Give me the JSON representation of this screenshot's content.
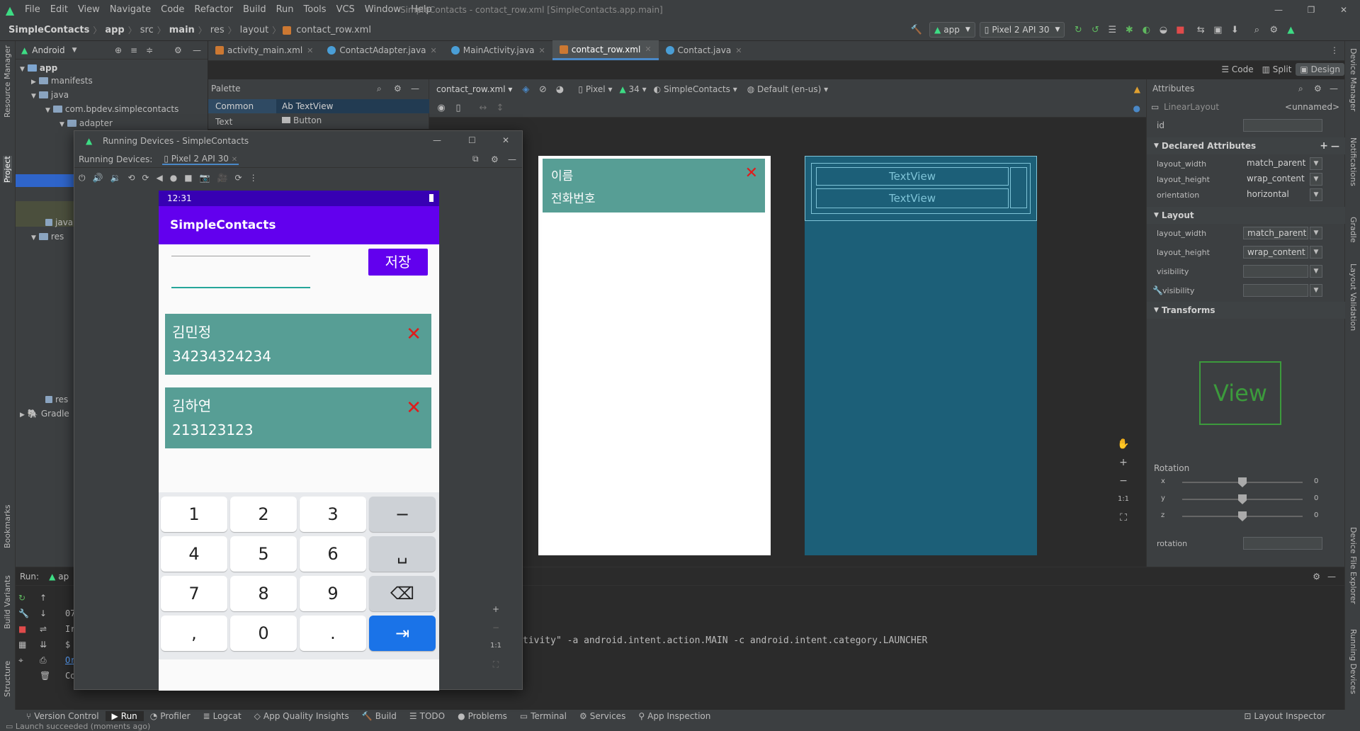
{
  "menu": [
    "File",
    "Edit",
    "View",
    "Navigate",
    "Code",
    "Refactor",
    "Build",
    "Run",
    "Tools",
    "VCS",
    "Window",
    "Help"
  ],
  "window_title": "SimpleContacts - contact_row.xml [SimpleContacts.app.main]",
  "breadcrumb": [
    "SimpleContacts",
    "app",
    "src",
    "main",
    "res",
    "layout",
    "contact_row.xml"
  ],
  "run_config": {
    "module": "app",
    "device": "Pixel 2 API 30"
  },
  "project": {
    "view_label": "Android",
    "rows": [
      "app",
      "manifests",
      "java",
      "com.bpdev.simplecontacts",
      "adapter",
      "java",
      "res",
      "res",
      "Gradle"
    ]
  },
  "tabs": [
    {
      "label": "activity_main.xml",
      "color": "#cc7832",
      "active": false
    },
    {
      "label": "ContactAdapter.java",
      "color": "#4a9ed6",
      "active": false
    },
    {
      "label": "MainActivity.java",
      "color": "#4a9ed6",
      "active": false
    },
    {
      "label": "contact_row.xml",
      "color": "#cc7832",
      "active": true
    },
    {
      "label": "Contact.java",
      "color": "#4a9ed6",
      "active": false
    }
  ],
  "view_modes": {
    "code": "Code",
    "split": "Split",
    "design": "Design"
  },
  "palette": {
    "title": "Palette",
    "categories": [
      "Common",
      "Text"
    ],
    "items": [
      "Ab TextView",
      "Button"
    ]
  },
  "design_toolbar": {
    "file": "contact_row.xml",
    "device": "Pixel",
    "api": "34",
    "theme": "SimpleContacts",
    "locale": "Default (en-us)"
  },
  "preview": {
    "name": "이름",
    "phone": "전화번호",
    "blueprint_text1": "TextView",
    "blueprint_text2": "TextView"
  },
  "attributes": {
    "title": "Attributes",
    "component": "LinearLayout",
    "component_id": "<unnamed>",
    "id_label": "id",
    "declared_title": "Declared Attributes",
    "declared": [
      {
        "name": "layout_width",
        "value": "match_parent"
      },
      {
        "name": "layout_height",
        "value": "wrap_content"
      },
      {
        "name": "orientation",
        "value": "horizontal"
      }
    ],
    "layout_title": "Layout",
    "layout": [
      {
        "name": "layout_width",
        "value": "match_parent"
      },
      {
        "name": "layout_height",
        "value": "wrap_content"
      },
      {
        "name": "visibility",
        "value": ""
      },
      {
        "name": "visibility",
        "value": ""
      }
    ],
    "transforms_title": "Transforms",
    "view_box": "View",
    "rotation_title": "Rotation",
    "rotation_axes": [
      "x",
      "y",
      "z"
    ],
    "rotation_values": [
      "0",
      "0",
      "0"
    ],
    "rotation_label": "rotation"
  },
  "emulator": {
    "title": "Running Devices - SimpleContacts",
    "tab_label": "Running Devices:",
    "device": "Pixel 2 API 30",
    "time": "12:31",
    "app_title": "SimpleContacts",
    "save_button": "저장",
    "contacts": [
      {
        "name": "김민정",
        "phone": "34234324234"
      },
      {
        "name": "김하연",
        "phone": "213123123"
      }
    ],
    "keys": [
      "1",
      "2",
      "3",
      "−",
      "4",
      "5",
      "6",
      "␣",
      "7",
      "8",
      "9",
      "⌫",
      ",",
      "0",
      ".",
      "⇥"
    ]
  },
  "run": {
    "label": "Run:",
    "config": "ap",
    "lines": [
      "07",
      "Ir",
      "$",
      "Or",
      "Co"
    ],
    "command": "tivity\" -a android.intent.action.MAIN -c android.intent.category.LAUNCHER"
  },
  "bottom_tools": [
    "Version Control",
    "Run",
    "Profiler",
    "Logcat",
    "App Quality Insights",
    "Build",
    "TODO",
    "Problems",
    "Terminal",
    "Services",
    "App Inspection"
  ],
  "layout_inspector": "Layout Inspector",
  "status_text": "Launch succeeded (moments ago)",
  "left_tool_windows": [
    "Resource Manager",
    "Project",
    "Bookmarks",
    "Build Variants",
    "Structure"
  ],
  "right_tool_windows": [
    "Device Manager",
    "Notifications",
    "Gradle",
    "Layout Validation",
    "Device File Explorer",
    "Running Devices"
  ]
}
